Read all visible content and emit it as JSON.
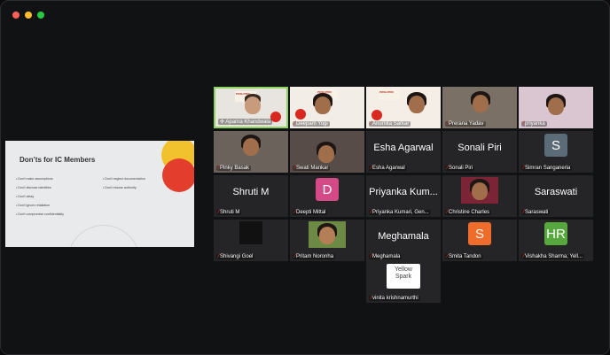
{
  "slide": {
    "title": "Don’ts for IC Members",
    "col1": [
      "Don't make assumptions",
      "Don't disclose identities",
      "Don't delay",
      "Don't ignore retaliation",
      "Don't compromise confidentiality"
    ],
    "col2": [
      "Don't neglect documentation",
      "Don't misuse authority"
    ]
  },
  "banner_text": "POSH PRO",
  "tiles": [
    {
      "label": "Aparna Khandwala"
    },
    {
      "label": "Deepam Yogi"
    },
    {
      "label": "Anumita Sarkar"
    },
    {
      "label": "Prerana Yadav"
    },
    {
      "label": "priyanka"
    },
    {
      "label": "Pinky Basak"
    },
    {
      "label": "Swati Mankar"
    },
    {
      "label": "Esha Agarwal",
      "big": "Esha Agarwal"
    },
    {
      "label": "Sonali Piri",
      "big": "Sonali Piri"
    },
    {
      "label": "Simran Sanganeria",
      "initial": "S"
    },
    {
      "label": "Shruti M",
      "big": "Shruti M"
    },
    {
      "label": "Deepti Mittal",
      "initial": "D"
    },
    {
      "label": "Priyanka Kumari, Gen...",
      "big": "Priyanka Kum..."
    },
    {
      "label": "Christine Charles"
    },
    {
      "label": "Saraswati",
      "big": "Saraswati"
    },
    {
      "label": "Shivangi Goel"
    },
    {
      "label": "Pritam Noronha"
    },
    {
      "label": "Meghamala",
      "big": "Meghamala"
    },
    {
      "label": "Smita Tandon",
      "initial": "S"
    },
    {
      "label": "Vishakha Sharma; Yell...",
      "initial": "HR"
    },
    {
      "label": "vinita krishnamurthi",
      "logo": "Yellow Spark"
    }
  ],
  "colors": {
    "active_border": "#8ed35c",
    "mic_muted": "#e0302b",
    "simran": "#5b6b78",
    "deepti": "#d34a86",
    "smita": "#f06c2a",
    "vishakha": "#57a83c"
  }
}
